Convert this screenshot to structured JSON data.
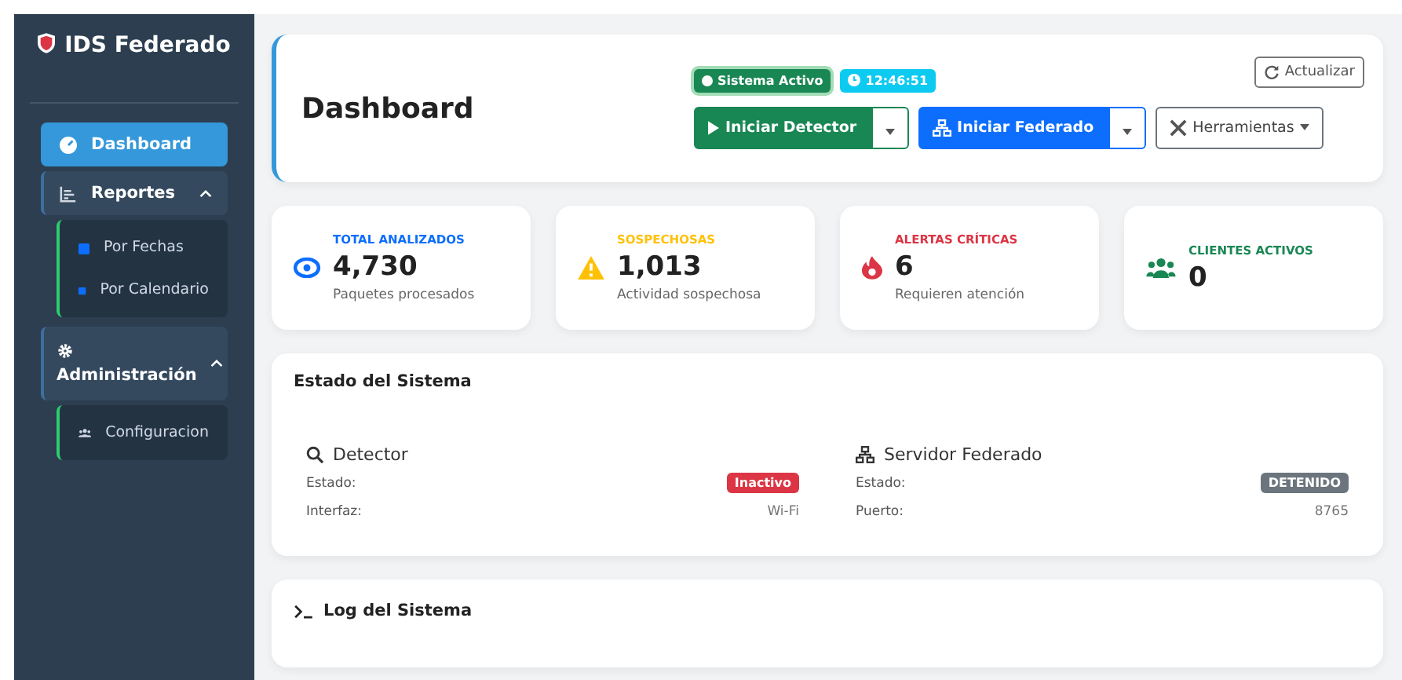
{
  "sidebar": {
    "brand": "IDS Federado",
    "items": [
      {
        "label": "Dashboard",
        "selected": true,
        "expanded": false
      },
      {
        "label": "Reportes",
        "selected": false,
        "expanded": true,
        "children": [
          {
            "label": "Por Fechas"
          },
          {
            "label": "Por Calendario"
          }
        ]
      },
      {
        "label": "Administración",
        "selected": false,
        "expanded": true,
        "children": [
          {
            "label": "Configuracion"
          }
        ]
      }
    ]
  },
  "header": {
    "title": "Dashboard",
    "status": "Sistema Activo",
    "time": "12:46:51",
    "refresh": "Actualizar",
    "actions": [
      {
        "label": "Iniciar Detector",
        "kind": "split",
        "color": "#198754"
      },
      {
        "label": "Iniciar Federado",
        "kind": "split",
        "color": "#0d6efd"
      },
      {
        "label": "Herramientas",
        "kind": "dropdown",
        "color": "#6c757d"
      }
    ]
  },
  "stats": [
    {
      "label": "TOTAL ANALIZADOS",
      "value": "4,730",
      "note": "Paquetes procesados",
      "color": "#0d6efd"
    },
    {
      "label": "SOSPECHOSAS",
      "value": "1,013",
      "note": "Actividad sospechosa",
      "color": "#ffc107"
    },
    {
      "label": "ALERTAS CRÍTICAS",
      "value": "6",
      "note": "Requieren atención",
      "color": "#dc3545"
    },
    {
      "label": "CLIENTES ACTIVOS",
      "value": "0",
      "color": "#198754"
    }
  ],
  "system": {
    "title": "Estado del Sistema",
    "panels": [
      {
        "title": "Detector",
        "rows": [
          {
            "label": "Estado:",
            "value": "Inactivo",
            "kind": "badge",
            "color": "#dc3545"
          },
          {
            "label": "Interfaz:",
            "value": "Wi-Fi",
            "kind": "text"
          }
        ]
      },
      {
        "title": "Servidor Federado",
        "rows": [
          {
            "label": "Estado:",
            "value": "DETENIDO",
            "kind": "badge",
            "color": "#6c757d"
          },
          {
            "label": "Puerto:",
            "value": "8765",
            "kind": "text"
          }
        ]
      }
    ]
  },
  "log": {
    "title": "Log del Sistema"
  }
}
